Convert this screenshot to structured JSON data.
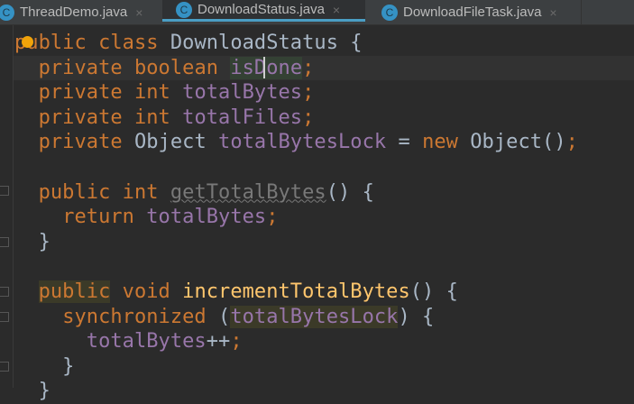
{
  "tabs": [
    {
      "label": "ThreadDemo.java",
      "icon": "class-icon",
      "icon_letter": "C",
      "active": false
    },
    {
      "label": "DownloadStatus.java",
      "icon": "class-icon",
      "icon_letter": "C",
      "active": true
    },
    {
      "label": "DownloadFileTask.java",
      "icon": "class-icon",
      "icon_letter": "C",
      "active": false
    }
  ],
  "close_glyph": "×",
  "colors": {
    "keyword": "#cc7832",
    "field": "#9876aa",
    "method": "#ffc66d",
    "plain": "#a9b7c6",
    "accent": "#4a9ec4"
  },
  "code": [
    [
      [
        "kw",
        "public"
      ],
      [
        "pl",
        " "
      ],
      [
        "kw",
        "class"
      ],
      [
        "pl",
        " DownloadStatus {"
      ]
    ],
    [
      [
        "pl",
        "  "
      ],
      [
        "kw",
        "private"
      ],
      [
        "pl",
        " "
      ],
      [
        "kw",
        "boolean"
      ],
      [
        "pl",
        " "
      ],
      [
        "fld hlg",
        "isDone"
      ],
      [
        "kw",
        ";"
      ]
    ],
    [
      [
        "pl",
        "  "
      ],
      [
        "kw",
        "private"
      ],
      [
        "pl",
        " "
      ],
      [
        "kw",
        "int"
      ],
      [
        "pl",
        " "
      ],
      [
        "fld",
        "totalBytes"
      ],
      [
        "kw",
        ";"
      ]
    ],
    [
      [
        "pl",
        "  "
      ],
      [
        "kw",
        "private"
      ],
      [
        "pl",
        " "
      ],
      [
        "kw",
        "int"
      ],
      [
        "pl",
        " "
      ],
      [
        "fld",
        "totalFiles"
      ],
      [
        "kw",
        ";"
      ]
    ],
    [
      [
        "pl",
        "  "
      ],
      [
        "kw",
        "private"
      ],
      [
        "pl",
        " Object "
      ],
      [
        "fld",
        "totalBytesLock"
      ],
      [
        "pl",
        " = "
      ],
      [
        "kw",
        "new"
      ],
      [
        "pl",
        " Object()"
      ],
      [
        "kw",
        ";"
      ]
    ],
    [],
    [
      [
        "pl",
        "  "
      ],
      [
        "kw",
        "public"
      ],
      [
        "pl",
        " "
      ],
      [
        "kw",
        "int"
      ],
      [
        "pl",
        " "
      ],
      [
        "unused",
        "getTotalBytes"
      ],
      [
        "pl",
        "() {"
      ]
    ],
    [
      [
        "pl",
        "    "
      ],
      [
        "kw",
        "return"
      ],
      [
        "pl",
        " "
      ],
      [
        "fld",
        "totalBytes"
      ],
      [
        "kw",
        ";"
      ]
    ],
    [
      [
        "pl",
        "  }"
      ]
    ],
    [],
    [
      [
        "pl",
        "  "
      ],
      [
        "kw hl",
        "public"
      ],
      [
        "pl",
        " "
      ],
      [
        "kw",
        "void"
      ],
      [
        "pl",
        " "
      ],
      [
        "fn",
        "incrementTotalBytes"
      ],
      [
        "pl",
        "() {"
      ]
    ],
    [
      [
        "pl",
        "    "
      ],
      [
        "kw",
        "synchronized"
      ],
      [
        "pl",
        " ("
      ],
      [
        "fld hl",
        "totalBytesLock"
      ],
      [
        "pl",
        ") {"
      ]
    ],
    [
      [
        "pl",
        "      "
      ],
      [
        "fld",
        "totalBytes"
      ],
      [
        "pl",
        "++"
      ],
      [
        "kw",
        ";"
      ]
    ],
    [
      [
        "pl",
        "    }"
      ]
    ],
    [
      [
        "pl",
        "  }"
      ]
    ]
  ]
}
